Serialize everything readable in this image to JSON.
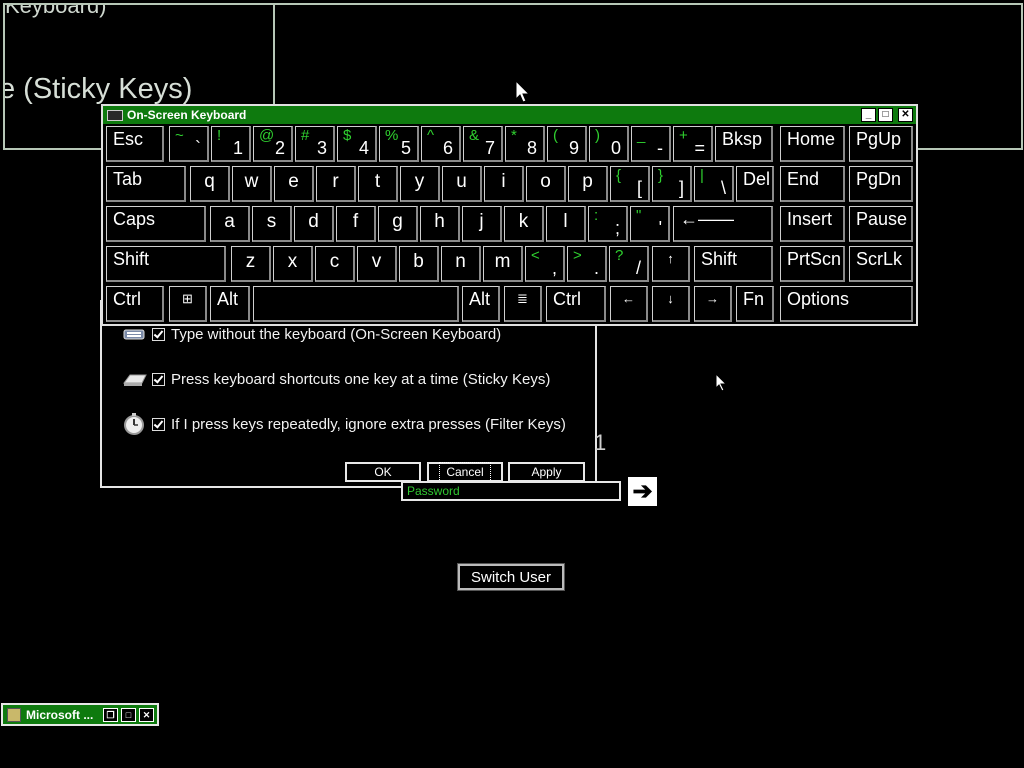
{
  "background": {
    "top_text": "Keyboard)",
    "sticky_text": "e (Sticky Keys)"
  },
  "ease_dialog": {
    "options": [
      {
        "label": "Type without the keyboard (On-Screen Keyboard)",
        "icon": "keyboard-icon",
        "checked": true
      },
      {
        "label": "Press keyboard shortcuts one key at a time (Sticky Keys)",
        "icon": "sticky-keys-icon",
        "checked": true
      },
      {
        "label": "If I press keys repeatedly, ignore extra presses (Filter Keys)",
        "icon": "stopwatch-icon",
        "checked": true
      }
    ],
    "ok_label": "OK",
    "cancel_label": "Cancel",
    "apply_label": "Apply"
  },
  "logon": {
    "password_placeholder": "Password",
    "partial_digit": "1",
    "go_arrow": "➔",
    "switch_user_label": "Switch User"
  },
  "osk": {
    "title": "On-Screen Keyboard",
    "minimize": "_",
    "maximize": "□",
    "close": "✕",
    "keys": {
      "esc": "Esc",
      "bksp": "Bksp",
      "home": "Home",
      "pgup": "PgUp",
      "tab": "Tab",
      "del": "Del",
      "end": "End",
      "pgdn": "PgDn",
      "caps": "Caps",
      "enter": "←——",
      "insert": "Insert",
      "pause": "Pause",
      "shift_l": "Shift",
      "shift_r": "Shift",
      "prtscn": "PrtScn",
      "scrlk": "ScrLk",
      "ctrl_l": "Ctrl",
      "win": "⊞",
      "alt_l": "Alt",
      "alt_r": "Alt",
      "menu": "≣",
      "ctrl_r": "Ctrl",
      "left": "←",
      "down": "↓",
      "right": "→",
      "up": "↑",
      "fn": "Fn",
      "options": "Options"
    },
    "row1": [
      {
        "top": "~",
        "bot": "`"
      },
      {
        "top": "!",
        "bot": "1"
      },
      {
        "top": "@",
        "bot": "2"
      },
      {
        "top": "#",
        "bot": "3"
      },
      {
        "top": "$",
        "bot": "4"
      },
      {
        "top": "%",
        "bot": "5"
      },
      {
        "top": "^",
        "bot": "6"
      },
      {
        "top": "&",
        "bot": "7"
      },
      {
        "top": "*",
        "bot": "8"
      },
      {
        "top": "(",
        "bot": "9"
      },
      {
        "top": ")",
        "bot": "0"
      },
      {
        "top": "_",
        "bot": "-"
      },
      {
        "top": "+",
        "bot": "="
      }
    ],
    "row2": [
      "q",
      "w",
      "e",
      "r",
      "t",
      "y",
      "u",
      "i",
      "o",
      "p",
      {
        "top": "{",
        "bot": "["
      },
      {
        "top": "}",
        "bot": "]"
      },
      {
        "top": "|",
        "bot": "\\"
      }
    ],
    "row3": [
      "a",
      "s",
      "d",
      "f",
      "g",
      "h",
      "j",
      "k",
      "l",
      {
        "top": ":",
        "bot": ";"
      },
      {
        "top": "\"",
        "bot": "'"
      }
    ],
    "row4": [
      "z",
      "x",
      "c",
      "v",
      "b",
      "n",
      "m",
      {
        "top": "<",
        "bot": ","
      },
      {
        "top": ">",
        "bot": "."
      },
      {
        "top": "?",
        "bot": "/"
      }
    ]
  },
  "taskbar": {
    "item_label": "Microsoft ...",
    "restore": "❐",
    "maximize": "□",
    "close": "✕"
  },
  "colors": {
    "title_green": "#0e7a0e",
    "symbol_green": "#2fd02f",
    "background": "#000000"
  }
}
